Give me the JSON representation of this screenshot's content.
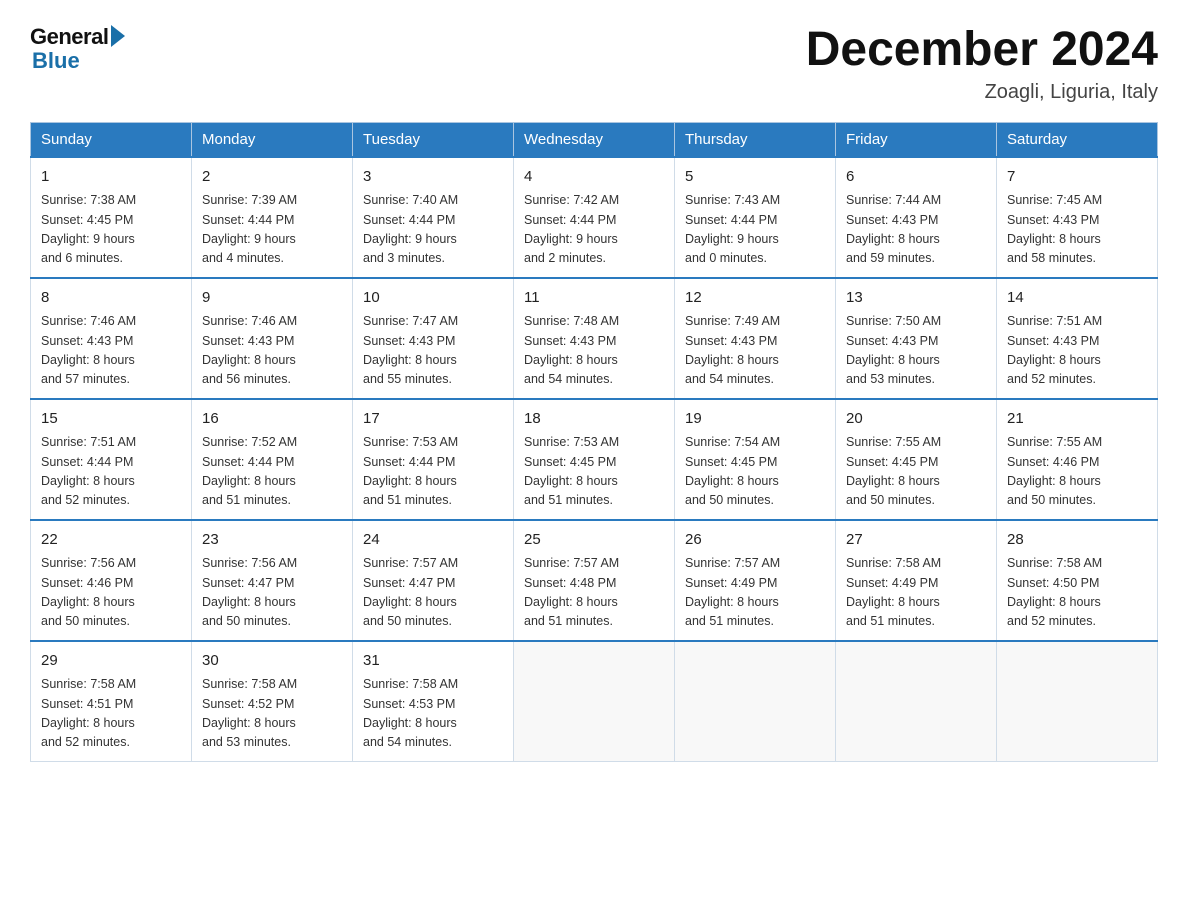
{
  "logo": {
    "general": "General",
    "blue": "Blue"
  },
  "title": "December 2024",
  "subtitle": "Zoagli, Liguria, Italy",
  "weekdays": [
    "Sunday",
    "Monday",
    "Tuesday",
    "Wednesday",
    "Thursday",
    "Friday",
    "Saturday"
  ],
  "weeks": [
    [
      {
        "day": "1",
        "info": "Sunrise: 7:38 AM\nSunset: 4:45 PM\nDaylight: 9 hours\nand 6 minutes."
      },
      {
        "day": "2",
        "info": "Sunrise: 7:39 AM\nSunset: 4:44 PM\nDaylight: 9 hours\nand 4 minutes."
      },
      {
        "day": "3",
        "info": "Sunrise: 7:40 AM\nSunset: 4:44 PM\nDaylight: 9 hours\nand 3 minutes."
      },
      {
        "day": "4",
        "info": "Sunrise: 7:42 AM\nSunset: 4:44 PM\nDaylight: 9 hours\nand 2 minutes."
      },
      {
        "day": "5",
        "info": "Sunrise: 7:43 AM\nSunset: 4:44 PM\nDaylight: 9 hours\nand 0 minutes."
      },
      {
        "day": "6",
        "info": "Sunrise: 7:44 AM\nSunset: 4:43 PM\nDaylight: 8 hours\nand 59 minutes."
      },
      {
        "day": "7",
        "info": "Sunrise: 7:45 AM\nSunset: 4:43 PM\nDaylight: 8 hours\nand 58 minutes."
      }
    ],
    [
      {
        "day": "8",
        "info": "Sunrise: 7:46 AM\nSunset: 4:43 PM\nDaylight: 8 hours\nand 57 minutes."
      },
      {
        "day": "9",
        "info": "Sunrise: 7:46 AM\nSunset: 4:43 PM\nDaylight: 8 hours\nand 56 minutes."
      },
      {
        "day": "10",
        "info": "Sunrise: 7:47 AM\nSunset: 4:43 PM\nDaylight: 8 hours\nand 55 minutes."
      },
      {
        "day": "11",
        "info": "Sunrise: 7:48 AM\nSunset: 4:43 PM\nDaylight: 8 hours\nand 54 minutes."
      },
      {
        "day": "12",
        "info": "Sunrise: 7:49 AM\nSunset: 4:43 PM\nDaylight: 8 hours\nand 54 minutes."
      },
      {
        "day": "13",
        "info": "Sunrise: 7:50 AM\nSunset: 4:43 PM\nDaylight: 8 hours\nand 53 minutes."
      },
      {
        "day": "14",
        "info": "Sunrise: 7:51 AM\nSunset: 4:43 PM\nDaylight: 8 hours\nand 52 minutes."
      }
    ],
    [
      {
        "day": "15",
        "info": "Sunrise: 7:51 AM\nSunset: 4:44 PM\nDaylight: 8 hours\nand 52 minutes."
      },
      {
        "day": "16",
        "info": "Sunrise: 7:52 AM\nSunset: 4:44 PM\nDaylight: 8 hours\nand 51 minutes."
      },
      {
        "day": "17",
        "info": "Sunrise: 7:53 AM\nSunset: 4:44 PM\nDaylight: 8 hours\nand 51 minutes."
      },
      {
        "day": "18",
        "info": "Sunrise: 7:53 AM\nSunset: 4:45 PM\nDaylight: 8 hours\nand 51 minutes."
      },
      {
        "day": "19",
        "info": "Sunrise: 7:54 AM\nSunset: 4:45 PM\nDaylight: 8 hours\nand 50 minutes."
      },
      {
        "day": "20",
        "info": "Sunrise: 7:55 AM\nSunset: 4:45 PM\nDaylight: 8 hours\nand 50 minutes."
      },
      {
        "day": "21",
        "info": "Sunrise: 7:55 AM\nSunset: 4:46 PM\nDaylight: 8 hours\nand 50 minutes."
      }
    ],
    [
      {
        "day": "22",
        "info": "Sunrise: 7:56 AM\nSunset: 4:46 PM\nDaylight: 8 hours\nand 50 minutes."
      },
      {
        "day": "23",
        "info": "Sunrise: 7:56 AM\nSunset: 4:47 PM\nDaylight: 8 hours\nand 50 minutes."
      },
      {
        "day": "24",
        "info": "Sunrise: 7:57 AM\nSunset: 4:47 PM\nDaylight: 8 hours\nand 50 minutes."
      },
      {
        "day": "25",
        "info": "Sunrise: 7:57 AM\nSunset: 4:48 PM\nDaylight: 8 hours\nand 51 minutes."
      },
      {
        "day": "26",
        "info": "Sunrise: 7:57 AM\nSunset: 4:49 PM\nDaylight: 8 hours\nand 51 minutes."
      },
      {
        "day": "27",
        "info": "Sunrise: 7:58 AM\nSunset: 4:49 PM\nDaylight: 8 hours\nand 51 minutes."
      },
      {
        "day": "28",
        "info": "Sunrise: 7:58 AM\nSunset: 4:50 PM\nDaylight: 8 hours\nand 52 minutes."
      }
    ],
    [
      {
        "day": "29",
        "info": "Sunrise: 7:58 AM\nSunset: 4:51 PM\nDaylight: 8 hours\nand 52 minutes."
      },
      {
        "day": "30",
        "info": "Sunrise: 7:58 AM\nSunset: 4:52 PM\nDaylight: 8 hours\nand 53 minutes."
      },
      {
        "day": "31",
        "info": "Sunrise: 7:58 AM\nSunset: 4:53 PM\nDaylight: 8 hours\nand 54 minutes."
      },
      {
        "day": "",
        "info": ""
      },
      {
        "day": "",
        "info": ""
      },
      {
        "day": "",
        "info": ""
      },
      {
        "day": "",
        "info": ""
      }
    ]
  ]
}
